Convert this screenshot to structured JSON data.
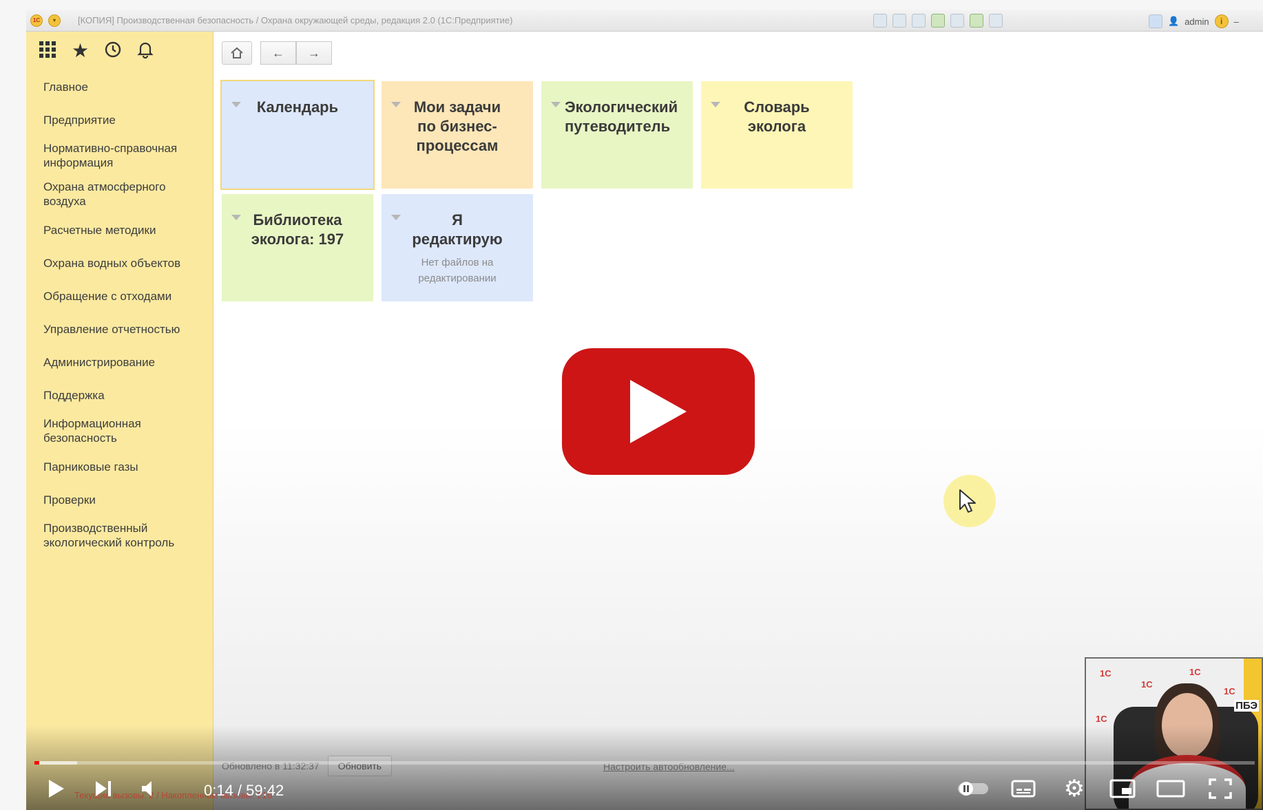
{
  "window": {
    "title": "[КОПИЯ] Производственная безопасность / Охрана окружающей среды, редакция 2.0  (1С:Предприятие)",
    "logo_text": "1С",
    "user": "admin",
    "info_glyph": "i"
  },
  "sidebar": {
    "icons": [
      "apps-grid-icon",
      "star-icon",
      "history-icon",
      "bell-icon"
    ],
    "items": [
      {
        "label": "Главное"
      },
      {
        "label": "Предприятие"
      },
      {
        "label": "Нормативно-справочная информация"
      },
      {
        "label": "Охрана атмосферного воздуха"
      },
      {
        "label": "Расчетные методики"
      },
      {
        "label": "Охрана водных объектов"
      },
      {
        "label": "Обращение с отходами"
      },
      {
        "label": "Управление отчетностью"
      },
      {
        "label": "Администрирование"
      },
      {
        "label": "Поддержка"
      },
      {
        "label": "Информационная безопасность"
      },
      {
        "label": "Парниковые газы"
      },
      {
        "label": "Проверки"
      },
      {
        "label": "Производственный экологический контроль"
      }
    ]
  },
  "tiles": [
    {
      "title": "Календарь",
      "subtitle": "",
      "color": "#dde8fb"
    },
    {
      "title": "Мои задачи по бизнес-процессам",
      "subtitle": "",
      "color": "#fde6b8"
    },
    {
      "title": "Экологический путеводитель",
      "subtitle": "",
      "color": "#e8f6c4"
    },
    {
      "title": "Словарь эколога",
      "subtitle": "",
      "color": "#fdf6b6"
    },
    {
      "title": "Библиотека эколога: 197",
      "subtitle": "",
      "color": "#e8f6c4"
    },
    {
      "title": "Я редактирую",
      "subtitle": "Нет файлов на редактировании",
      "color": "#dde8fb"
    }
  ],
  "footer": {
    "updated_text": "Обновлено в 11:32:37",
    "update_button": "Обновить",
    "autoupdate_link": "Настроить автообновление..."
  },
  "player": {
    "time_current": "0:14",
    "time_total": "59:42",
    "time_display": "0:14 / 59:42",
    "progress_fraction": 0.0039,
    "buffer_fraction": 0.035,
    "accent_color": "#cd1516",
    "status_overlay": "Текущие вызовы: 2 / Накопленные вызовы: 216"
  },
  "webcam": {
    "badge": "ПБЭ"
  }
}
